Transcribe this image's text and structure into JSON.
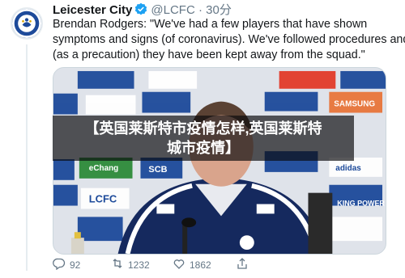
{
  "tweet": {
    "author_name": "Leicester City",
    "handle": "@LCFC",
    "separator": "·",
    "time": "30分",
    "text_lines": [
      "Brendan Rodgers: \"We've had a few players that have shown",
      "symptoms and signs (of coronavirus). We've followed procedures and",
      "(as a precaution) they have been kept away from the squad.\""
    ]
  },
  "overlay": {
    "lines": [
      "【英国莱斯特市疫情怎样,英国莱斯特",
      "城市疫情】"
    ]
  },
  "actions": {
    "replies": "92",
    "retweets": "1232",
    "likes": "1862"
  },
  "colors": {
    "brand_blue": "#1d4a9a",
    "verified_blue": "#1da1f2",
    "meta_gray": "#657786"
  },
  "icons": {
    "verified": "verified-badge-icon",
    "reply": "reply-icon",
    "retweet": "retweet-icon",
    "like": "like-icon",
    "share": "share-icon"
  },
  "media": {
    "backdrop_sponsors": [
      "SCB",
      "adidas",
      "KING POWER",
      "eChang",
      "LCFC",
      "SAMSUNG"
    ]
  }
}
